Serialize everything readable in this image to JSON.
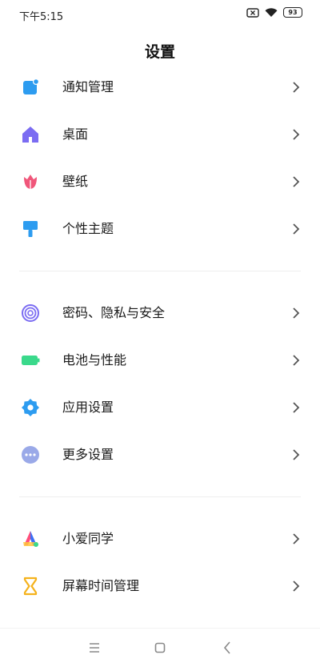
{
  "status": {
    "time": "下午5:15",
    "battery": "93",
    "icons": [
      "sim-off-icon",
      "wifi-icon",
      "battery-icon"
    ]
  },
  "header": {
    "title": "设置"
  },
  "sections": [
    {
      "items": [
        {
          "label": "通知管理",
          "icon": "notification-icon",
          "color": "#2d9cf0"
        },
        {
          "label": "桌面",
          "icon": "home-icon",
          "color": "#7b6cf2"
        },
        {
          "label": "壁纸",
          "icon": "flower-icon",
          "color": "#f0567a"
        },
        {
          "label": "个性主题",
          "icon": "brush-icon",
          "color": "#2d9cf0"
        }
      ]
    },
    {
      "items": [
        {
          "label": "密码、隐私与安全",
          "icon": "fingerprint-icon",
          "color": "#7b6cf2"
        },
        {
          "label": "电池与性能",
          "icon": "battery-icon",
          "color": "#3ad98b"
        },
        {
          "label": "应用设置",
          "icon": "gear-icon",
          "color": "#2d9cf0"
        },
        {
          "label": "更多设置",
          "icon": "more-icon",
          "color": "#9aa9e8"
        }
      ]
    },
    {
      "items": [
        {
          "label": "小爱同学",
          "icon": "xiaoai-icon",
          "color": "#ff6a3d"
        },
        {
          "label": "屏幕时间管理",
          "icon": "hourglass-icon",
          "color": "#f5b21c"
        }
      ]
    }
  ],
  "nav": [
    "menu-icon",
    "home-square-icon",
    "back-icon"
  ]
}
